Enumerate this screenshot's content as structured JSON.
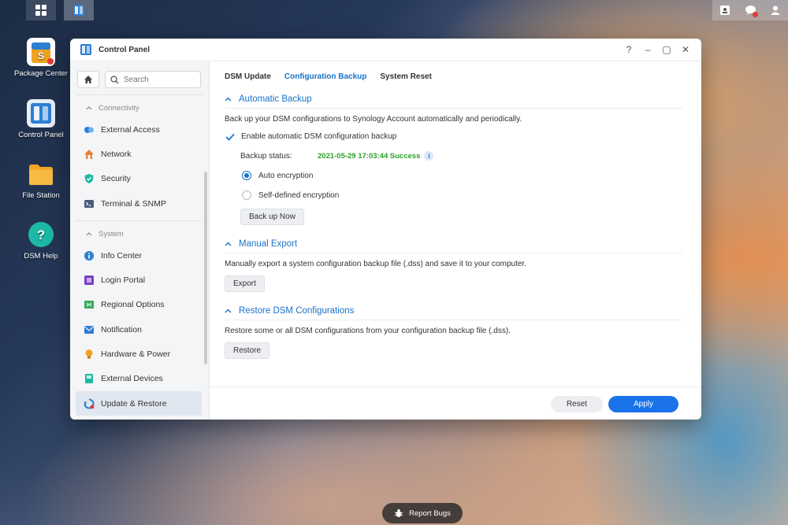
{
  "taskbar": {
    "main_menu_icon": "grid-icon",
    "open_app_icon": "control-panel-icon",
    "right_icons": [
      "user-card-icon",
      "chat-bubble-icon",
      "user-icon"
    ]
  },
  "desktop": {
    "icons": [
      {
        "label": "Package Center",
        "icon": "package-center-icon"
      },
      {
        "label": "Control Panel",
        "icon": "control-panel-icon"
      },
      {
        "label": "File Station",
        "icon": "folder-icon"
      },
      {
        "label": "DSM Help",
        "icon": "help-icon"
      }
    ]
  },
  "window": {
    "title": "Control Panel",
    "controls": [
      "?",
      "–",
      "▢",
      "✕"
    ]
  },
  "sidebar": {
    "search_placeholder": "Search",
    "groups": [
      {
        "label": "Connectivity",
        "items": [
          {
            "label": "External Access",
            "icon": "external-access-icon",
            "color": "#2d7fd3"
          },
          {
            "label": "Network",
            "icon": "house-network-icon",
            "color": "#e8823a"
          },
          {
            "label": "Security",
            "icon": "shield-icon",
            "color": "#1eb8a6"
          },
          {
            "label": "Terminal & SNMP",
            "icon": "terminal-icon",
            "color": "#4a5a78"
          }
        ]
      },
      {
        "label": "System",
        "items": [
          {
            "label": "Info Center",
            "icon": "info-icon",
            "color": "#2d7fd3"
          },
          {
            "label": "Login Portal",
            "icon": "portal-icon",
            "color": "#7a3fc4"
          },
          {
            "label": "Regional Options",
            "icon": "map-icon",
            "color": "#39a85a"
          },
          {
            "label": "Notification",
            "icon": "notification-icon",
            "color": "#2d7fd3"
          },
          {
            "label": "Hardware & Power",
            "icon": "bulb-icon",
            "color": "#f0a323"
          },
          {
            "label": "External Devices",
            "icon": "device-icon",
            "color": "#1eb8a6"
          },
          {
            "label": "Update & Restore",
            "icon": "update-icon",
            "color": "#2d7fd3"
          }
        ]
      }
    ],
    "selected": "Update & Restore"
  },
  "tabs": {
    "items": [
      "DSM Update",
      "Configuration Backup",
      "System Reset"
    ],
    "active": "Configuration Backup"
  },
  "sections": {
    "automatic_backup": {
      "title": "Automatic Backup",
      "description": "Back up your DSM configurations to Synology Account automatically and periodically.",
      "enable_label": "Enable automatic DSM configuration backup",
      "enable_checked": true,
      "status_label": "Backup status:",
      "status_value": "2021-05-29 17:03:44 Success",
      "auto_encryption_label": "Auto encryption",
      "self_defined_label": "Self-defined encryption",
      "selected_encryption": "Auto encryption",
      "backup_button": "Back up Now"
    },
    "manual_export": {
      "title": "Manual Export",
      "description": "Manually export a system configuration backup file (.dss) and save it to your computer.",
      "button": "Export"
    },
    "restore": {
      "title": "Restore DSM Configurations",
      "description": "Restore some or all DSM configurations from your configuration backup file (.dss).",
      "button": "Restore"
    }
  },
  "footer": {
    "reset_label": "Reset",
    "apply_label": "Apply"
  },
  "report_bugs": {
    "label": "Report Bugs",
    "icon": "bug-icon"
  },
  "colors": {
    "accent": "#1a73c9",
    "apply_button": "#1a73e8",
    "success": "#2ca02c"
  }
}
